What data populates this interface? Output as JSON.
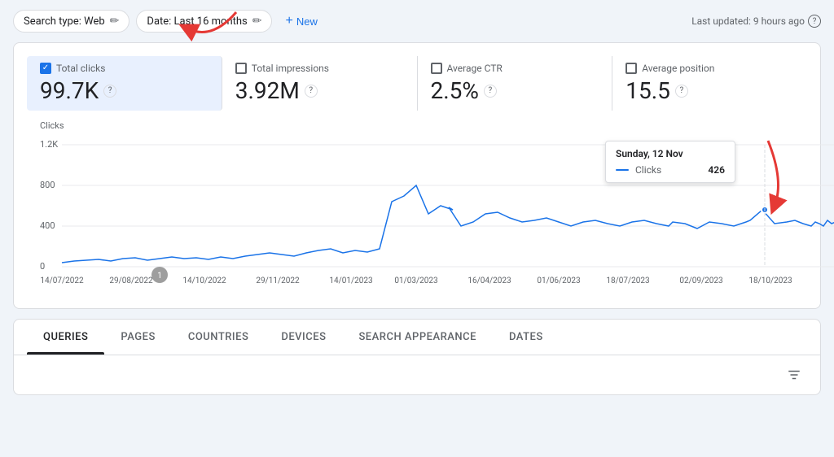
{
  "topBar": {
    "searchTypeLabel": "Search type: Web",
    "dateLabel": "Date: Last 16 months",
    "newLabel": "New",
    "lastUpdated": "Last updated: 9 hours ago"
  },
  "metrics": [
    {
      "id": "total-clicks",
      "label": "Total clicks",
      "value": "99.7K",
      "checked": true
    },
    {
      "id": "total-impressions",
      "label": "Total impressions",
      "value": "3.92M",
      "checked": false
    },
    {
      "id": "average-ctr",
      "label": "Average CTR",
      "value": "2.5%",
      "checked": false
    },
    {
      "id": "average-position",
      "label": "Average position",
      "value": "15.5",
      "checked": false
    }
  ],
  "chart": {
    "yAxisLabel": "Clicks",
    "yAxisTicks": [
      "1.2K",
      "800",
      "400",
      "0"
    ],
    "xAxisLabels": [
      "14/07/2022",
      "29/08/2022",
      "14/10/2022",
      "29/11/2022",
      "14/01/2023",
      "01/03/2023",
      "16/04/2023",
      "01/06/2023",
      "18/07/2023",
      "02/09/2023",
      "18/10/2023"
    ],
    "tooltip": {
      "date": "Sunday, 12 Nov",
      "metricLabel": "Clicks",
      "metricValue": "426"
    }
  },
  "tabs": [
    {
      "id": "queries",
      "label": "QUERIES",
      "active": true
    },
    {
      "id": "pages",
      "label": "PAGES",
      "active": false
    },
    {
      "id": "countries",
      "label": "COUNTRIES",
      "active": false
    },
    {
      "id": "devices",
      "label": "DEVICES",
      "active": false
    },
    {
      "id": "search-appearance",
      "label": "SEARCH APPEARANCE",
      "active": false
    },
    {
      "id": "dates",
      "label": "DATES",
      "active": false
    }
  ],
  "icons": {
    "edit": "✏",
    "plus": "+",
    "help": "?",
    "filter": "≡",
    "check": "✓"
  },
  "colors": {
    "blue": "#1a73e8",
    "activeMetricBg": "#e8f0fe",
    "chartLine": "#1a73e8",
    "tooltipDot": "#1a73e8"
  }
}
